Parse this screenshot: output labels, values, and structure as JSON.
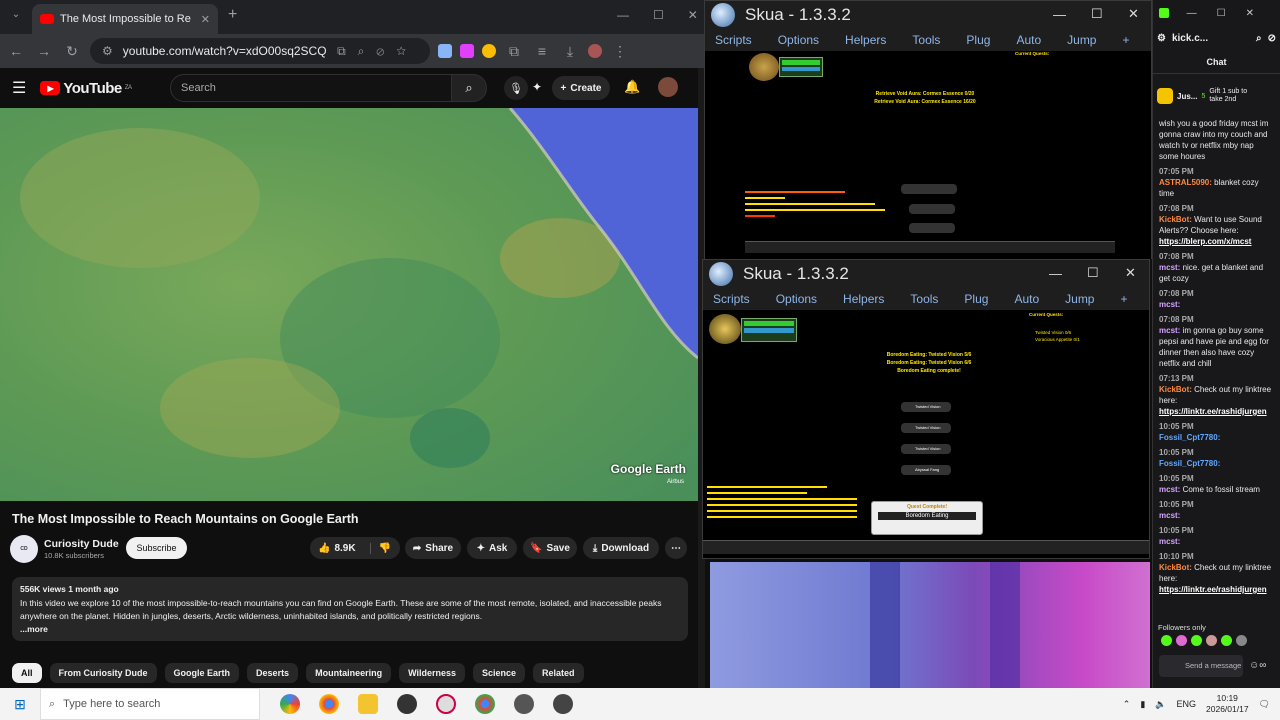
{
  "browser": {
    "tab_title": "The Most Impossible to Re",
    "new_tab": "+",
    "url": "youtube.com/watch?v=xdO00sq2SCQ"
  },
  "youtube": {
    "logo": "YouTube",
    "logo_region": "ZA",
    "search_placeholder": "Search",
    "create_label": "Create",
    "video_watermark": "Google Earth",
    "video_credit": "Airbus",
    "title": "The Most Impossible to Reach Mountains on Google Earth",
    "channel": "Curiosity Dude",
    "subscribers": "10.8K subscribers",
    "subscribe_label": "Subscribe",
    "likes": "8.9K",
    "share_label": "Share",
    "ask_label": "Ask",
    "save_label": "Save",
    "download_label": "Download",
    "views_meta": "556K views  1 month ago",
    "description": "In this video we explore 10 of the most impossible-to-reach mountains you can find on Google Earth. These are some of the most remote, isolated, and inaccessible peaks anywhere on the planet. Hidden in jungles, deserts, Arctic wilderness, uninhabited islands, and politically restricted regions.",
    "more_label": "...more",
    "chips": [
      "All",
      "From Curiosity Dude",
      "Google Earth",
      "Deserts",
      "Mountaineering",
      "Wilderness",
      "Science",
      "Related"
    ]
  },
  "skua_top": {
    "title": "Skua - 1.3.3.2",
    "menu": [
      "Scripts",
      "Options",
      "Helpers",
      "Tools",
      "Plug",
      "Auto",
      "Jump",
      "+"
    ],
    "quest_header": "Current Quests:",
    "lines": [
      "Retrieve Void Aura: Cormex Essence 0/20",
      "Retrieve Void Aura: Cormex Essence 16/20"
    ]
  },
  "skua_bottom": {
    "title": "Skua - 1.3.3.2",
    "menu": [
      "Scripts",
      "Options",
      "Helpers",
      "Tools",
      "Plug",
      "Auto",
      "Jump",
      "+"
    ],
    "quest_header": "Current Quests:",
    "quest_items": [
      "Twisted Vision 0/6",
      "Voracious Appetite 0/1"
    ],
    "lines": [
      "Boredom Eating: Twisted Vision 5/6",
      "Boredom Eating: Twisted Vision 6/6",
      "Boredom Eating complete!"
    ],
    "drops": [
      "Twisted Vision",
      "Twisted Vision",
      "Twisted Vision",
      "Abyssal Fang"
    ],
    "quest_complete": "Quest Complete!",
    "quest_complete_name": "Boredom Eating"
  },
  "kick": {
    "tab_label": "kick.c...",
    "chat_label": "Chat",
    "pinned_user": "Jus...",
    "pinned_count": "5",
    "gift_text": "Gift 1 sub to take 2nd",
    "messages": [
      {
        "time": "",
        "user": "",
        "text": "wish you a good friday mcst im gonna craw into my couch and watch tv or netflix mby nap some houres"
      },
      {
        "time": "07:05 PM",
        "user": "ASTRAL5090:",
        "text": "blanket cozy time"
      },
      {
        "time": "07:08 PM",
        "user": "KickBot:",
        "text": "Want to use Sound Alerts?? Choose here:",
        "link": "https://blerp.com/x/mcst"
      },
      {
        "time": "07:08 PM",
        "user": "mcst:",
        "text": "nice. get a blanket and get cozy"
      },
      {
        "time": "07:08 PM",
        "user": "mcst:",
        "text": ""
      },
      {
        "time": "07:08 PM",
        "user": "mcst:",
        "text": "im gonna go buy some pepsi and have pie and egg for dinner then also have cozy netflix and chill"
      },
      {
        "time": "07:13 PM",
        "user": "KickBot:",
        "text": "Check out my linktree here:",
        "link": "https://linktr.ee/rashidjurgen"
      },
      {
        "time": "10:05 PM",
        "user": "Fossil_Cpt7780:",
        "text": ""
      },
      {
        "time": "10:05 PM",
        "user": "Fossil_Cpt7780:",
        "text": ""
      },
      {
        "time": "10:05 PM",
        "user": "mcst:",
        "text": "Come to fossil stream"
      },
      {
        "time": "10:05 PM",
        "user": "mcst:",
        "text": ""
      },
      {
        "time": "10:05 PM",
        "user": "mcst:",
        "text": ""
      },
      {
        "time": "10:10 PM",
        "user": "KickBot:",
        "text": "Check out my linktree here:",
        "link": "https://linktr.ee/rashidjurgen"
      }
    ],
    "followers_only": "Followers only",
    "send_placeholder": "Send a message",
    "colors": {
      "kick_green": "#53fc18",
      "astral": "#ff8a3d",
      "kickbot": "#ff8a3d",
      "mcst": "#d6a3ff",
      "fossil": "#5fa8ff"
    }
  },
  "taskbar": {
    "search_placeholder": "Type here to search",
    "lang": "ENG",
    "time": "10:19",
    "date": "2026/01/17"
  }
}
